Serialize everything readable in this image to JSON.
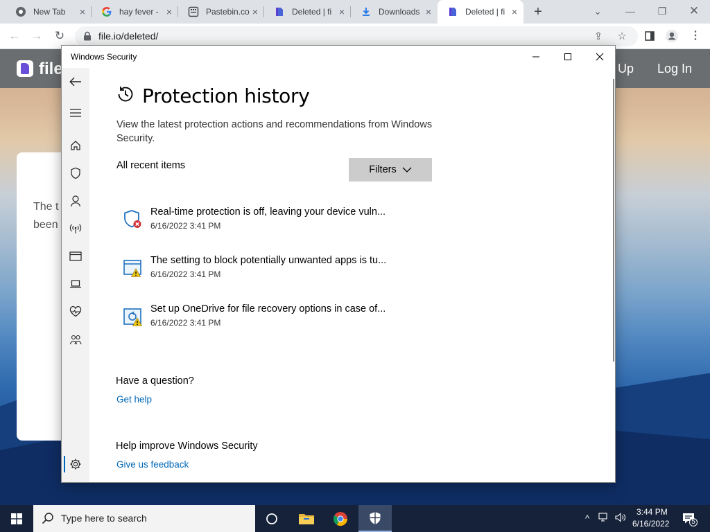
{
  "browser": {
    "tabs": [
      {
        "title": "New Tab",
        "icon": "chrome-icon"
      },
      {
        "title": "hay fever -",
        "icon": "google-icon"
      },
      {
        "title": "Pastebin.co",
        "icon": "pastebin-icon"
      },
      {
        "title": "Deleted | fi",
        "icon": "fileio-icon"
      },
      {
        "title": "Downloads",
        "icon": "download-icon"
      },
      {
        "title": "Deleted | fi",
        "icon": "fileio-icon",
        "active": true
      }
    ],
    "url": "file.io/deleted/"
  },
  "website": {
    "name": "file",
    "signup": "Up",
    "login": "Log In",
    "text_line1": "The t",
    "text_line2": "been"
  },
  "window": {
    "title": "Windows Security"
  },
  "security": {
    "title": "Protection history",
    "description": "View the latest protection actions and recommendations from Windows Security.",
    "recent_label": "All recent items",
    "filters_label": "Filters",
    "items": [
      {
        "text": "Real-time protection is off, leaving your device vuln...",
        "date": "6/16/2022 3:41 PM",
        "icon": "shield-error-icon"
      },
      {
        "text": "The setting to block potentially unwanted apps is tu...",
        "date": "6/16/2022 3:41 PM",
        "icon": "app-warning-icon"
      },
      {
        "text": "Set up OneDrive for file recovery options in case of...",
        "date": "6/16/2022 3:41 PM",
        "icon": "recovery-warning-icon"
      }
    ],
    "question_title": "Have a question?",
    "get_help": "Get help",
    "improve_title": "Help improve Windows Security",
    "feedback": "Give us feedback"
  },
  "taskbar": {
    "search_placeholder": "Type here to search",
    "time": "3:44 PM",
    "date": "6/16/2022",
    "notifications": "5"
  },
  "colors": {
    "link": "#0067b8",
    "taskbar": "#15223a",
    "filters_bg": "#cccccc"
  }
}
